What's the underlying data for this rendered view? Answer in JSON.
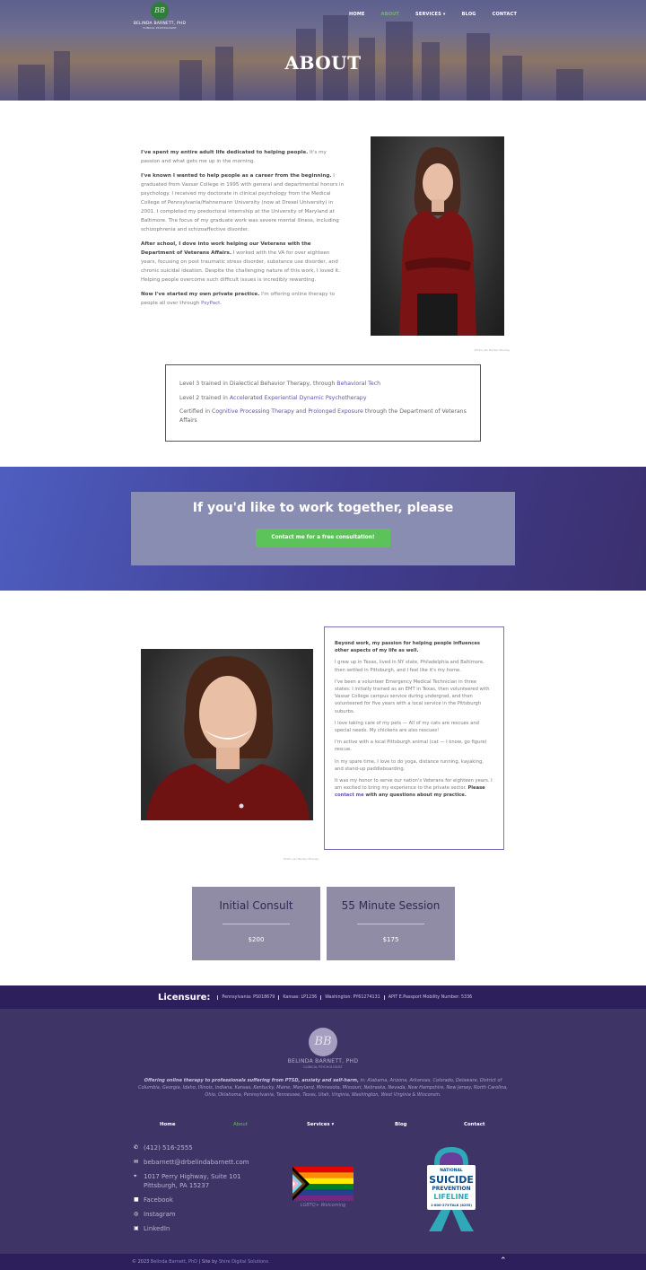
{
  "header": {
    "logo_initials": "BB",
    "logo_name": "BELINDA BARNETT, PHD",
    "logo_sub": "CLINICAL PSYCHOLOGIST",
    "nav": [
      "HOME",
      "ABOUT",
      "SERVICES ▾",
      "BLOG",
      "CONTACT"
    ],
    "active_nav": "ABOUT",
    "page_title": "ABOUT"
  },
  "intro": {
    "p1_bold": "I've spent my entire adult life dedicated to helping people.",
    "p1_rest": " It's my passion and what gets me up in the morning.",
    "p2_bold": "I've known I wanted to help people as a career from the beginning.",
    "p2_rest": " I graduated from Vassar College in 1995 with general and departmental honors in psychology. I received my doctorate in clinical psychology from the Medical College of Pennsylvania/Hahnemann University (now at Drexel University) in 2001. I completed my predoctoral internship at the University of Maryland at Baltimore. The focus of my graduate work was severe mental illness, including schizophrenia and schizoaffective disorder.",
    "p3_bold": "After school, I dove into work helping our Veterans with the Department of Veterans Affairs.",
    "p3_rest": " I worked with the VA for over eighteen years, focusing on post traumatic stress disorder, substance use disorder, and chronic suicidal ideation. Despite the challenging nature of this work, I loved it. Helping people overcome such difficult issues is incredibly rewarding.",
    "p4_bold": "Now I've started my own private practice.",
    "p4_rest": " I'm offering online therapy to people all over through ",
    "p4_link": "PsyPact",
    "p4_end": ".",
    "photo_credit": "Photo: Jan Becker Mooney"
  },
  "training": {
    "l1_text": "Level 3 trained in Dialectical Behavior Therapy, through ",
    "l1_link": "Behavioral Tech",
    "l2_text": "Level 2 trained in ",
    "l2_link": "Accelerated Experiential Dynamic Psychotherapy",
    "l3_text": "Certified in ",
    "l3_link1": "Cognitive Processing Therapy",
    "l3_and": " and ",
    "l3_link2": "Prolonged Exposure",
    "l3_end": " through the Department of Veterans Affairs"
  },
  "cta": {
    "title": "If you'd like to work together, please",
    "button": "Contact me for a free consultation!"
  },
  "bio": {
    "lead": "Beyond work, my passion for helping people influences other aspects of my life as well.",
    "p1": "I grew up in Texas, lived in NY state, Philadelphia and Baltimore, then settled in Pittsburgh, and I feel like it's my home.",
    "p2": "I've been a volunteer Emergency Medical Technician in three states: I initially trained as an EMT in Texas, then volunteered with Vassar College campus service during undergrad, and then volunteered for five years with a local service in the Pittsburgh suburbs.",
    "p3": "I love taking care of my pets — All of my cats are rescues and special needs. My chickens are also rescues!",
    "p4": "I'm active with a local Pittsburgh animal (cat — I know, go figure) rescue.",
    "p5": "In my spare time, I love to do yoga, distance running, kayaking, and stand-up paddleboarding.",
    "p6_text": "It was my honor to serve our nation's Veterans for eighteen years. I am excited to bring my experience to the private sector. ",
    "p6_please": "Please ",
    "p6_link": "contact me",
    "p6_end": " with any questions about my practice.",
    "photo_credit": "Photo: Jan Becker Mooney"
  },
  "prices": [
    {
      "name": "Initial Consult",
      "value": "$200"
    },
    {
      "name": "55 Minute Session",
      "value": "$175"
    }
  ],
  "licensure": {
    "title": "Licensure:",
    "items": [
      "Pennsylvania: PS018679",
      "Kansas: LP1236",
      "Washington: PY61274131",
      "APIT E.Passport Mobility Number: 5336"
    ]
  },
  "footer": {
    "logo_initials": "BB",
    "name": "BELINDA BARNETT, PHD",
    "sub": "CLINICAL PSYCHOLOGIST",
    "tag_bold": "Offering online therapy to professionals suffering from PTSD, anxiety and self-harm,",
    "tag_rest": " in: Alabama, Arizona, Arkansas, Colorado, Delaware, District of Columbia, Georgia, Idaho, Illinois, Indiana, Kansas, Kentucky, Maine, Maryland, Minnesota, Missouri, Nebraska, Nevada, New Hampshire, New Jersey, North Carolina, Ohio, Oklahoma, Pennsylvania, Tennessee, Texas, Utah, Virginia, Washington, West Virginia & Wisconsin.",
    "nav": [
      "Home",
      "About",
      "Services ▾",
      "Blog",
      "Contact"
    ],
    "phone": "(412) 516-2555",
    "email": "bebarnett@drbelindabarnett.com",
    "address1": "1017 Perry Highway, Suite 101",
    "address2": "Pittsburgh, PA 15237",
    "facebook": "Facebook",
    "instagram": "Instagram",
    "linkedin": "LinkedIn",
    "pride_label": "LGBTQ+ Welcoming",
    "lifeline_top": "NATIONAL",
    "lifeline_suicide": "SUICIDE",
    "lifeline_prevention": "PREVENTION",
    "lifeline_word": "LIFELINE",
    "lifeline_number": "1-800-273-TALK (8255)",
    "copyright_pre": "© 2023 ",
    "copyright_name": "Belinda Barnett, PhD",
    "copyright_mid": " | Site by ",
    "copyright_site": "Shire Digital Solutions"
  },
  "colors": {
    "accent_purple": "#3e3466",
    "cta_green": "#5bc35a",
    "link_purple": "#5b56ad"
  }
}
